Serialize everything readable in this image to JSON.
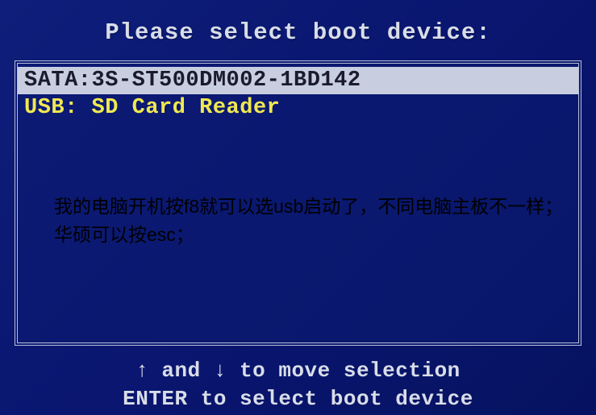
{
  "title": "Please select boot device:",
  "devices": [
    {
      "label": "SATA:3S-ST500DM002-1BD142",
      "selected": true
    },
    {
      "label": "USB: SD Card Reader",
      "selected": false
    }
  ],
  "annotation": "我的电脑开机按f8就可以选usb启动了，不同电脑主板不一样；华硕可以按esc；",
  "hints": {
    "line1_prefix": "↑ and ↓ ",
    "line1_text": "to move selection",
    "line2_prefix": "ENTER ",
    "line2_text": "to select boot device"
  }
}
